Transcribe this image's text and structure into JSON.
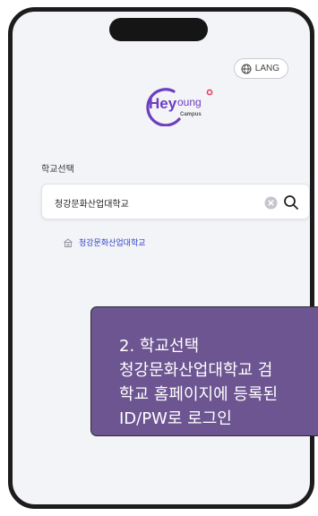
{
  "header": {
    "lang_label": "LANG",
    "lang_icon": "globe-icon"
  },
  "logo": {
    "hey": "Hey",
    "oung": "oung",
    "campus": "Campus"
  },
  "school_select": {
    "label": "학교선택",
    "input_value": "청강문화산업대학교",
    "clear_icon": "clear-icon",
    "search_icon": "search-icon"
  },
  "results": [
    {
      "label": "청강문화산업대학교",
      "icon": "school-icon"
    }
  ],
  "callout": {
    "title": "2. 학교선택",
    "line1": "청강문화산업대학교 검",
    "line2": "학교 홈페이지에 등록된",
    "line3": "ID/PW로 로그인"
  },
  "colors": {
    "accent": "#2d44c6",
    "logo_accent": "#6c3ec1",
    "callout_bg": "#6d5591",
    "phone_frame": "#1c1c1c",
    "screen_bg": "#f3f4f7"
  }
}
